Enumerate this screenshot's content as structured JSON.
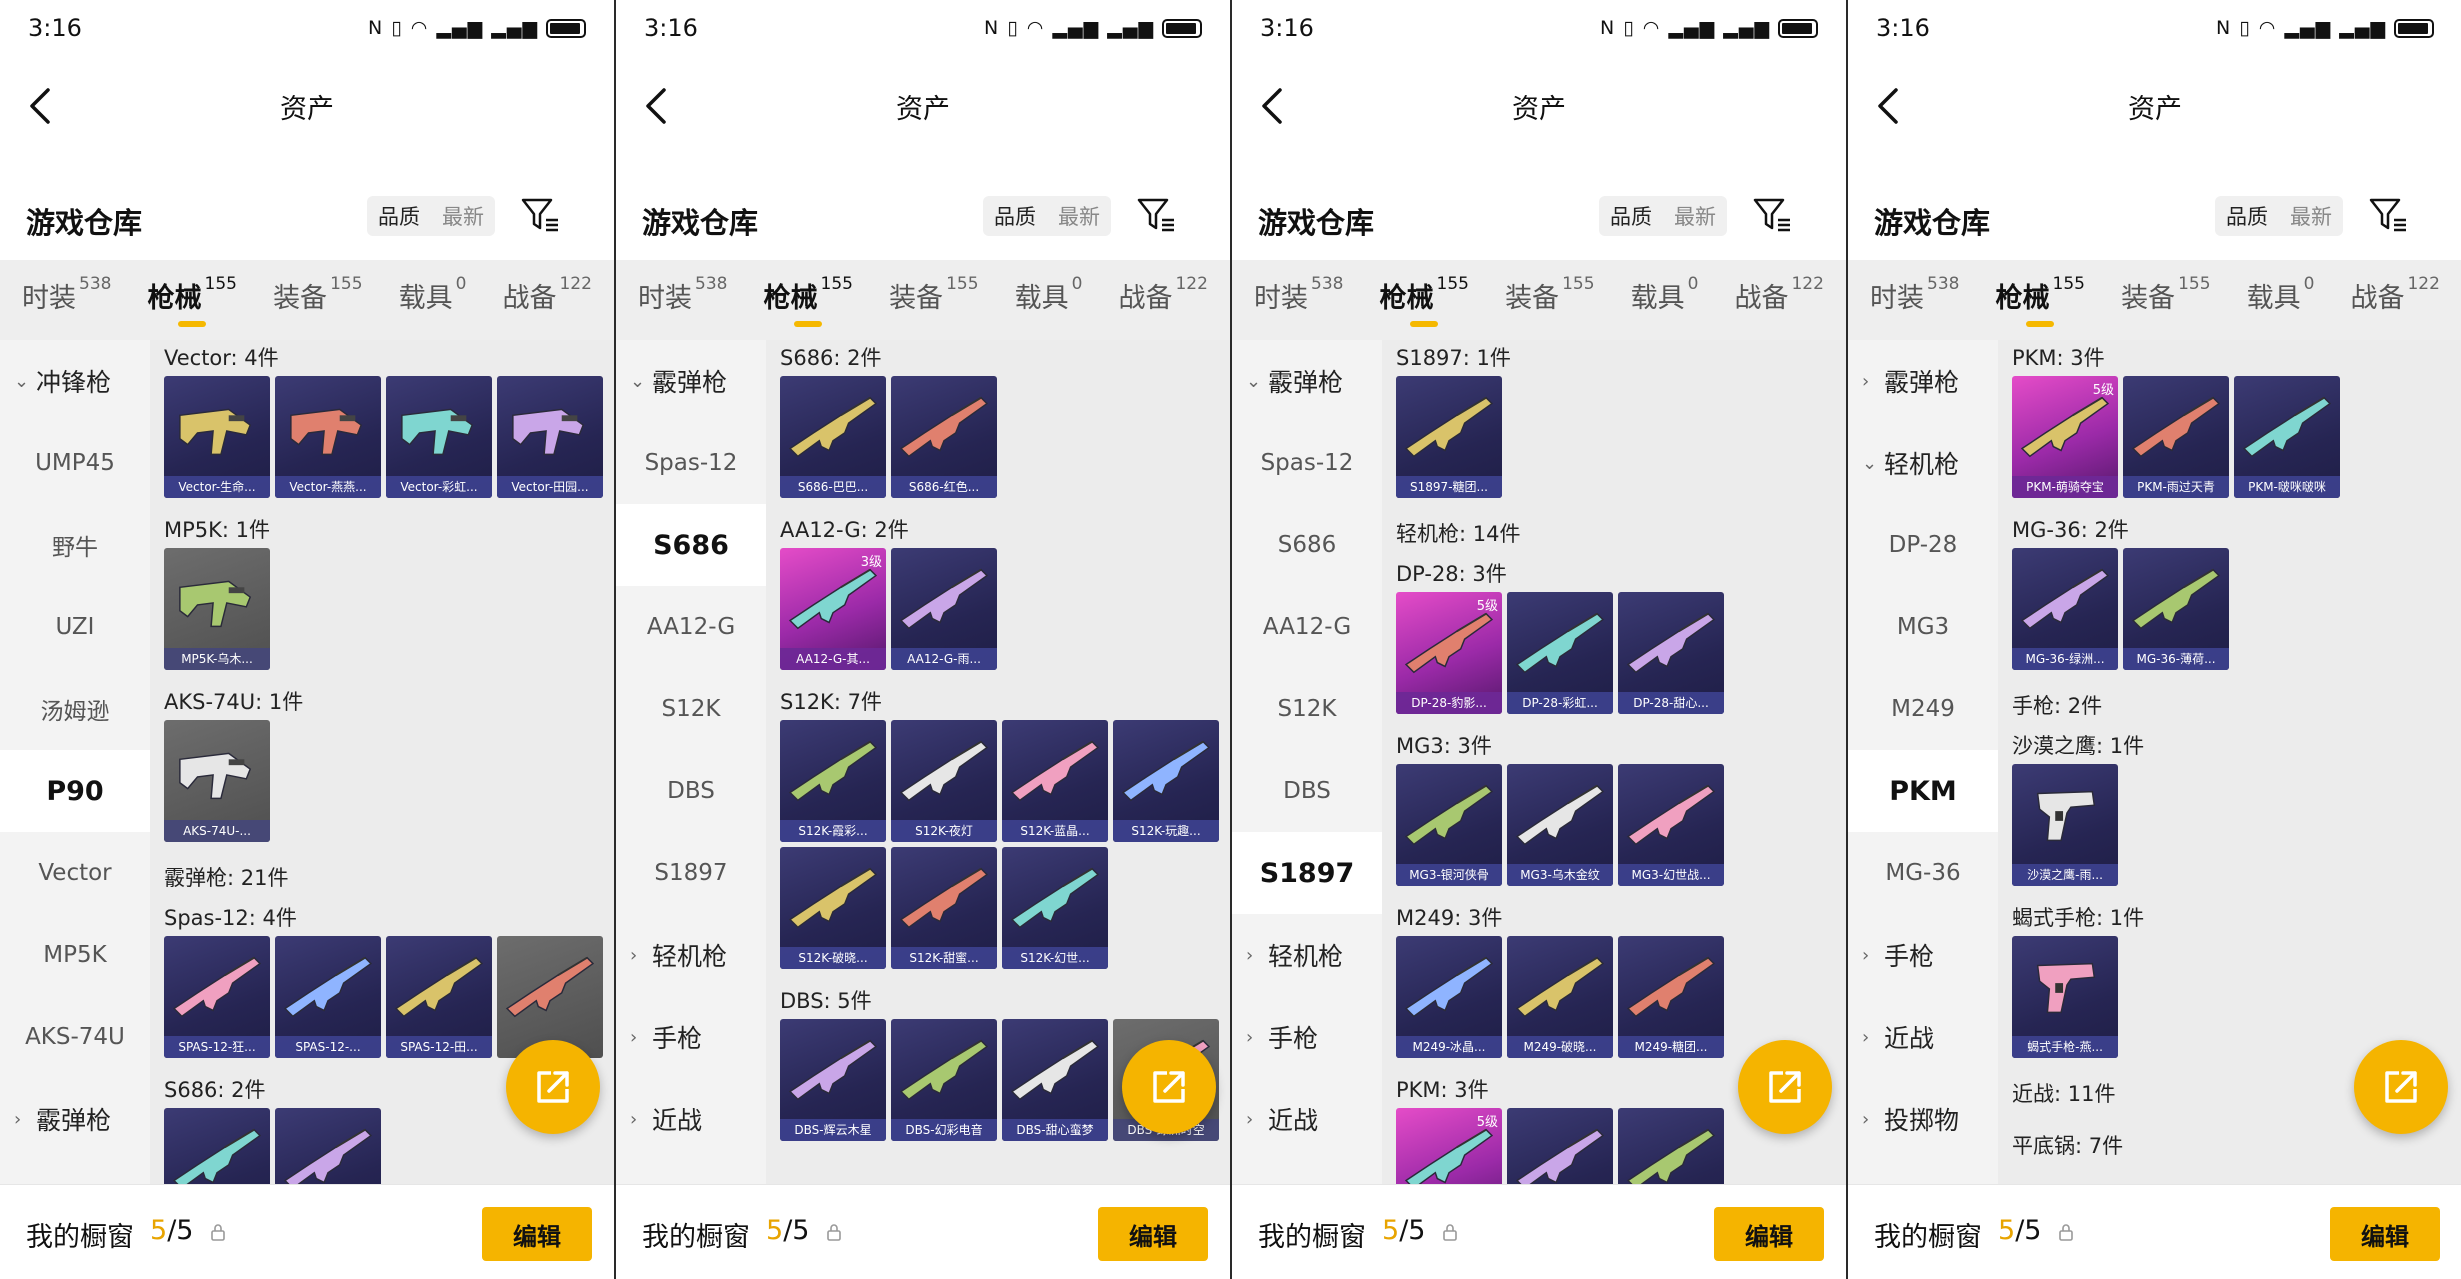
{
  "status": {
    "time": "3:16",
    "icons": "NFC vibrate wifi signal signal battery"
  },
  "nav": {
    "title": "资产"
  },
  "warehouse": {
    "title": "游戏仓库",
    "sort_quality": "品质",
    "sort_latest": "最新"
  },
  "tabs": [
    {
      "label": "时装",
      "count": "538"
    },
    {
      "label": "枪械",
      "count": "155"
    },
    {
      "label": "装备",
      "count": "155"
    },
    {
      "label": "载具",
      "count": "0"
    },
    {
      "label": "战备",
      "count": "122"
    }
  ],
  "bottom": {
    "label": "我的橱窗",
    "current": "5",
    "total": "/5",
    "edit": "编辑"
  },
  "colors": {
    "accent": "#f5b400",
    "legendary": "#c03cb8",
    "epic": "#2b2a5e"
  },
  "screens": [
    {
      "sidebar": [
        {
          "label": "冲锋枪",
          "type": "group",
          "expanded": true
        },
        {
          "label": "UMP45"
        },
        {
          "label": "野牛"
        },
        {
          "label": "UZI"
        },
        {
          "label": "汤姆逊"
        },
        {
          "label": "P90",
          "selected": true
        },
        {
          "label": "Vector"
        },
        {
          "label": "MP5K"
        },
        {
          "label": "AKS-74U"
        },
        {
          "label": "霰弹枪",
          "type": "group",
          "expanded": false
        }
      ],
      "sections": [
        {
          "title": "Vector: 4件",
          "items": [
            {
              "name": "Vector-生命...",
              "icon": "vector-smg-icon"
            },
            {
              "name": "Vector-燕燕...",
              "icon": "vector-smg-icon"
            },
            {
              "name": "Vector-彩虹...",
              "icon": "vector-smg-icon"
            },
            {
              "name": "Vector-田园...",
              "icon": "vector-smg-icon"
            }
          ]
        },
        {
          "title": "MP5K: 1件",
          "items": [
            {
              "name": "MP5K-乌木...",
              "icon": "mp5k-smg-icon",
              "gray": true
            }
          ]
        },
        {
          "title": "AKS-74U: 1件",
          "items": [
            {
              "name": "AKS-74U-...",
              "icon": "aks74u-smg-icon",
              "gray": true
            }
          ]
        },
        {
          "title": "霰弹枪: 21件",
          "category": true
        },
        {
          "title": "Spas-12: 4件",
          "items": [
            {
              "name": "SPAS-12-狂...",
              "icon": "shotgun-icon"
            },
            {
              "name": "SPAS-12-...",
              "icon": "shotgun-icon"
            },
            {
              "name": "SPAS-12-田...",
              "icon": "shotgun-icon"
            },
            {
              "name": "",
              "icon": "shotgun-icon",
              "gray": true
            }
          ]
        },
        {
          "title": "S686: 2件",
          "items": [
            {
              "name": "",
              "icon": "shotgun-icon"
            },
            {
              "name": "",
              "icon": "shotgun-icon"
            }
          ]
        }
      ]
    },
    {
      "sidebar": [
        {
          "label": "霰弹枪",
          "type": "group",
          "expanded": true
        },
        {
          "label": "Spas-12"
        },
        {
          "label": "S686",
          "selected": true
        },
        {
          "label": "AA12-G"
        },
        {
          "label": "S12K"
        },
        {
          "label": "DBS"
        },
        {
          "label": "S1897"
        },
        {
          "label": "轻机枪",
          "type": "group",
          "expanded": false
        },
        {
          "label": "手枪",
          "type": "group",
          "expanded": false
        },
        {
          "label": "近战",
          "type": "group",
          "expanded": false
        }
      ],
      "sections": [
        {
          "title": "S686: 2件",
          "items": [
            {
              "name": "S686-巴巴...",
              "icon": "shotgun-icon"
            },
            {
              "name": "S686-红色...",
              "icon": "shotgun-icon"
            }
          ]
        },
        {
          "title": "AA12-G: 2件",
          "items": [
            {
              "name": "AA12-G-其...",
              "icon": "auto-shotgun-icon",
              "legend": true,
              "level": "3级"
            },
            {
              "name": "AA12-G-雨...",
              "icon": "auto-shotgun-icon"
            }
          ]
        },
        {
          "title": "S12K: 7件",
          "items": [
            {
              "name": "S12K-霞彩...",
              "icon": "auto-shotgun-icon"
            },
            {
              "name": "S12K-夜灯",
              "icon": "auto-shotgun-icon"
            },
            {
              "name": "S12K-蓝晶...",
              "icon": "auto-shotgun-icon"
            },
            {
              "name": "S12K-玩趣...",
              "icon": "auto-shotgun-icon"
            },
            {
              "name": "S12K-破晓...",
              "icon": "auto-shotgun-icon"
            },
            {
              "name": "S12K-甜蜜...",
              "icon": "auto-shotgun-icon"
            },
            {
              "name": "S12K-幻世...",
              "icon": "auto-shotgun-icon"
            }
          ]
        },
        {
          "title": "DBS: 5件",
          "items": [
            {
              "name": "DBS-辉云木星",
              "icon": "shotgun-icon"
            },
            {
              "name": "DBS-幻彩电音",
              "icon": "shotgun-icon"
            },
            {
              "name": "DBS-甜心蛮梦",
              "icon": "shotgun-icon"
            },
            {
              "name": "DBS-绿洲时空",
              "icon": "shotgun-icon",
              "gray": true
            }
          ]
        }
      ]
    },
    {
      "sidebar": [
        {
          "label": "霰弹枪",
          "type": "group",
          "expanded": true
        },
        {
          "label": "Spas-12"
        },
        {
          "label": "S686"
        },
        {
          "label": "AA12-G"
        },
        {
          "label": "S12K"
        },
        {
          "label": "DBS"
        },
        {
          "label": "S1897",
          "selected": true
        },
        {
          "label": "轻机枪",
          "type": "group",
          "expanded": false
        },
        {
          "label": "手枪",
          "type": "group",
          "expanded": false
        },
        {
          "label": "近战",
          "type": "group",
          "expanded": false
        }
      ],
      "sections": [
        {
          "title": "S1897: 1件",
          "items": [
            {
              "name": "S1897-糖团...",
              "icon": "shotgun-icon"
            }
          ]
        },
        {
          "title": "轻机枪: 14件",
          "category": true
        },
        {
          "title": "DP-28: 3件",
          "items": [
            {
              "name": "DP-28-豹影...",
              "icon": "lmg-icon",
              "legend": true,
              "level": "5级"
            },
            {
              "name": "DP-28-彩虹...",
              "icon": "lmg-icon"
            },
            {
              "name": "DP-28-甜心...",
              "icon": "lmg-icon"
            }
          ]
        },
        {
          "title": "MG3: 3件",
          "items": [
            {
              "name": "MG3-银河侠骨",
              "icon": "lmg-icon"
            },
            {
              "name": "MG3-乌木金纹",
              "icon": "lmg-icon"
            },
            {
              "name": "MG3-幻世战...",
              "icon": "lmg-icon"
            }
          ]
        },
        {
          "title": "M249: 3件",
          "items": [
            {
              "name": "M249-冰晶...",
              "icon": "lmg-icon"
            },
            {
              "name": "M249-破晓...",
              "icon": "lmg-icon"
            },
            {
              "name": "M249-糖团...",
              "icon": "lmg-icon"
            }
          ]
        },
        {
          "title": "PKM: 3件",
          "items": [
            {
              "name": "",
              "icon": "lmg-icon",
              "legend": true,
              "level": "5级"
            },
            {
              "name": "",
              "icon": "lmg-icon"
            },
            {
              "name": "",
              "icon": "lmg-icon"
            }
          ]
        }
      ]
    },
    {
      "sidebar": [
        {
          "label": "霰弹枪",
          "type": "group",
          "expanded": false
        },
        {
          "label": "轻机枪",
          "type": "group",
          "expanded": true
        },
        {
          "label": "DP-28"
        },
        {
          "label": "MG3"
        },
        {
          "label": "M249"
        },
        {
          "label": "PKM",
          "selected": true
        },
        {
          "label": "MG-36"
        },
        {
          "label": "手枪",
          "type": "group",
          "expanded": false
        },
        {
          "label": "近战",
          "type": "group",
          "expanded": false
        },
        {
          "label": "投掷物",
          "type": "group",
          "expanded": false
        }
      ],
      "sections": [
        {
          "title": "PKM: 3件",
          "items": [
            {
              "name": "PKM-萌骑夺宝",
              "icon": "lmg-icon",
              "legend": true,
              "level": "5级"
            },
            {
              "name": "PKM-雨过天青",
              "icon": "lmg-icon"
            },
            {
              "name": "PKM-啵咪啵咪",
              "icon": "lmg-icon"
            }
          ]
        },
        {
          "title": "MG-36: 2件",
          "items": [
            {
              "name": "MG-36-绿洲...",
              "icon": "lmg-icon"
            },
            {
              "name": "MG-36-薄荷...",
              "icon": "lmg-icon"
            }
          ]
        },
        {
          "title": "手枪: 2件",
          "category": true
        },
        {
          "title": "沙漠之鹰: 1件",
          "items": [
            {
              "name": "沙漠之鹰-雨...",
              "icon": "pistol-icon"
            }
          ]
        },
        {
          "title": "蝎式手枪: 1件",
          "items": [
            {
              "name": "蝎式手枪-燕...",
              "icon": "machine-pistol-icon"
            }
          ]
        },
        {
          "title": "近战: 11件",
          "category": true
        },
        {
          "title": "平底锅: 7件",
          "category": true
        }
      ]
    }
  ]
}
